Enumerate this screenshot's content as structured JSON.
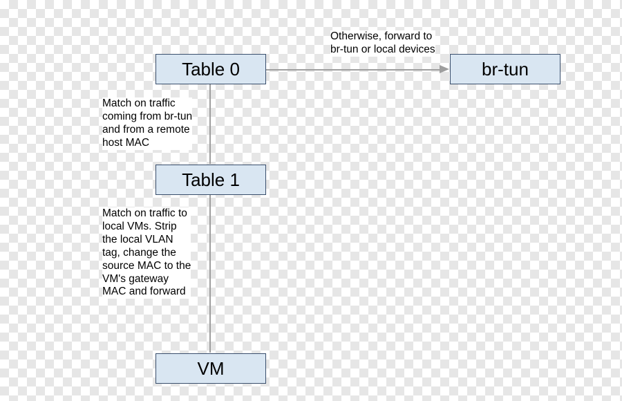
{
  "nodes": {
    "table0": "Table 0",
    "table1": "Table 1",
    "vm": "VM",
    "brtun": "br-tun"
  },
  "edges": {
    "table0_to_brtun": "Otherwise, forward to\nbr-tun or local devices",
    "table0_to_table1": "Match on traffic\ncoming from br-tun\nand from a remote\nhost MAC",
    "table1_to_vm": "Match on traffic to\nlocal VMs. Strip\nthe local VLAN\ntag, change the\nsource MAC to the\nVM's gateway\nMAC and forward"
  },
  "colors": {
    "box_fill": "#d9e6f2",
    "box_border": "#384d6b",
    "line": "#9e9e9e"
  }
}
